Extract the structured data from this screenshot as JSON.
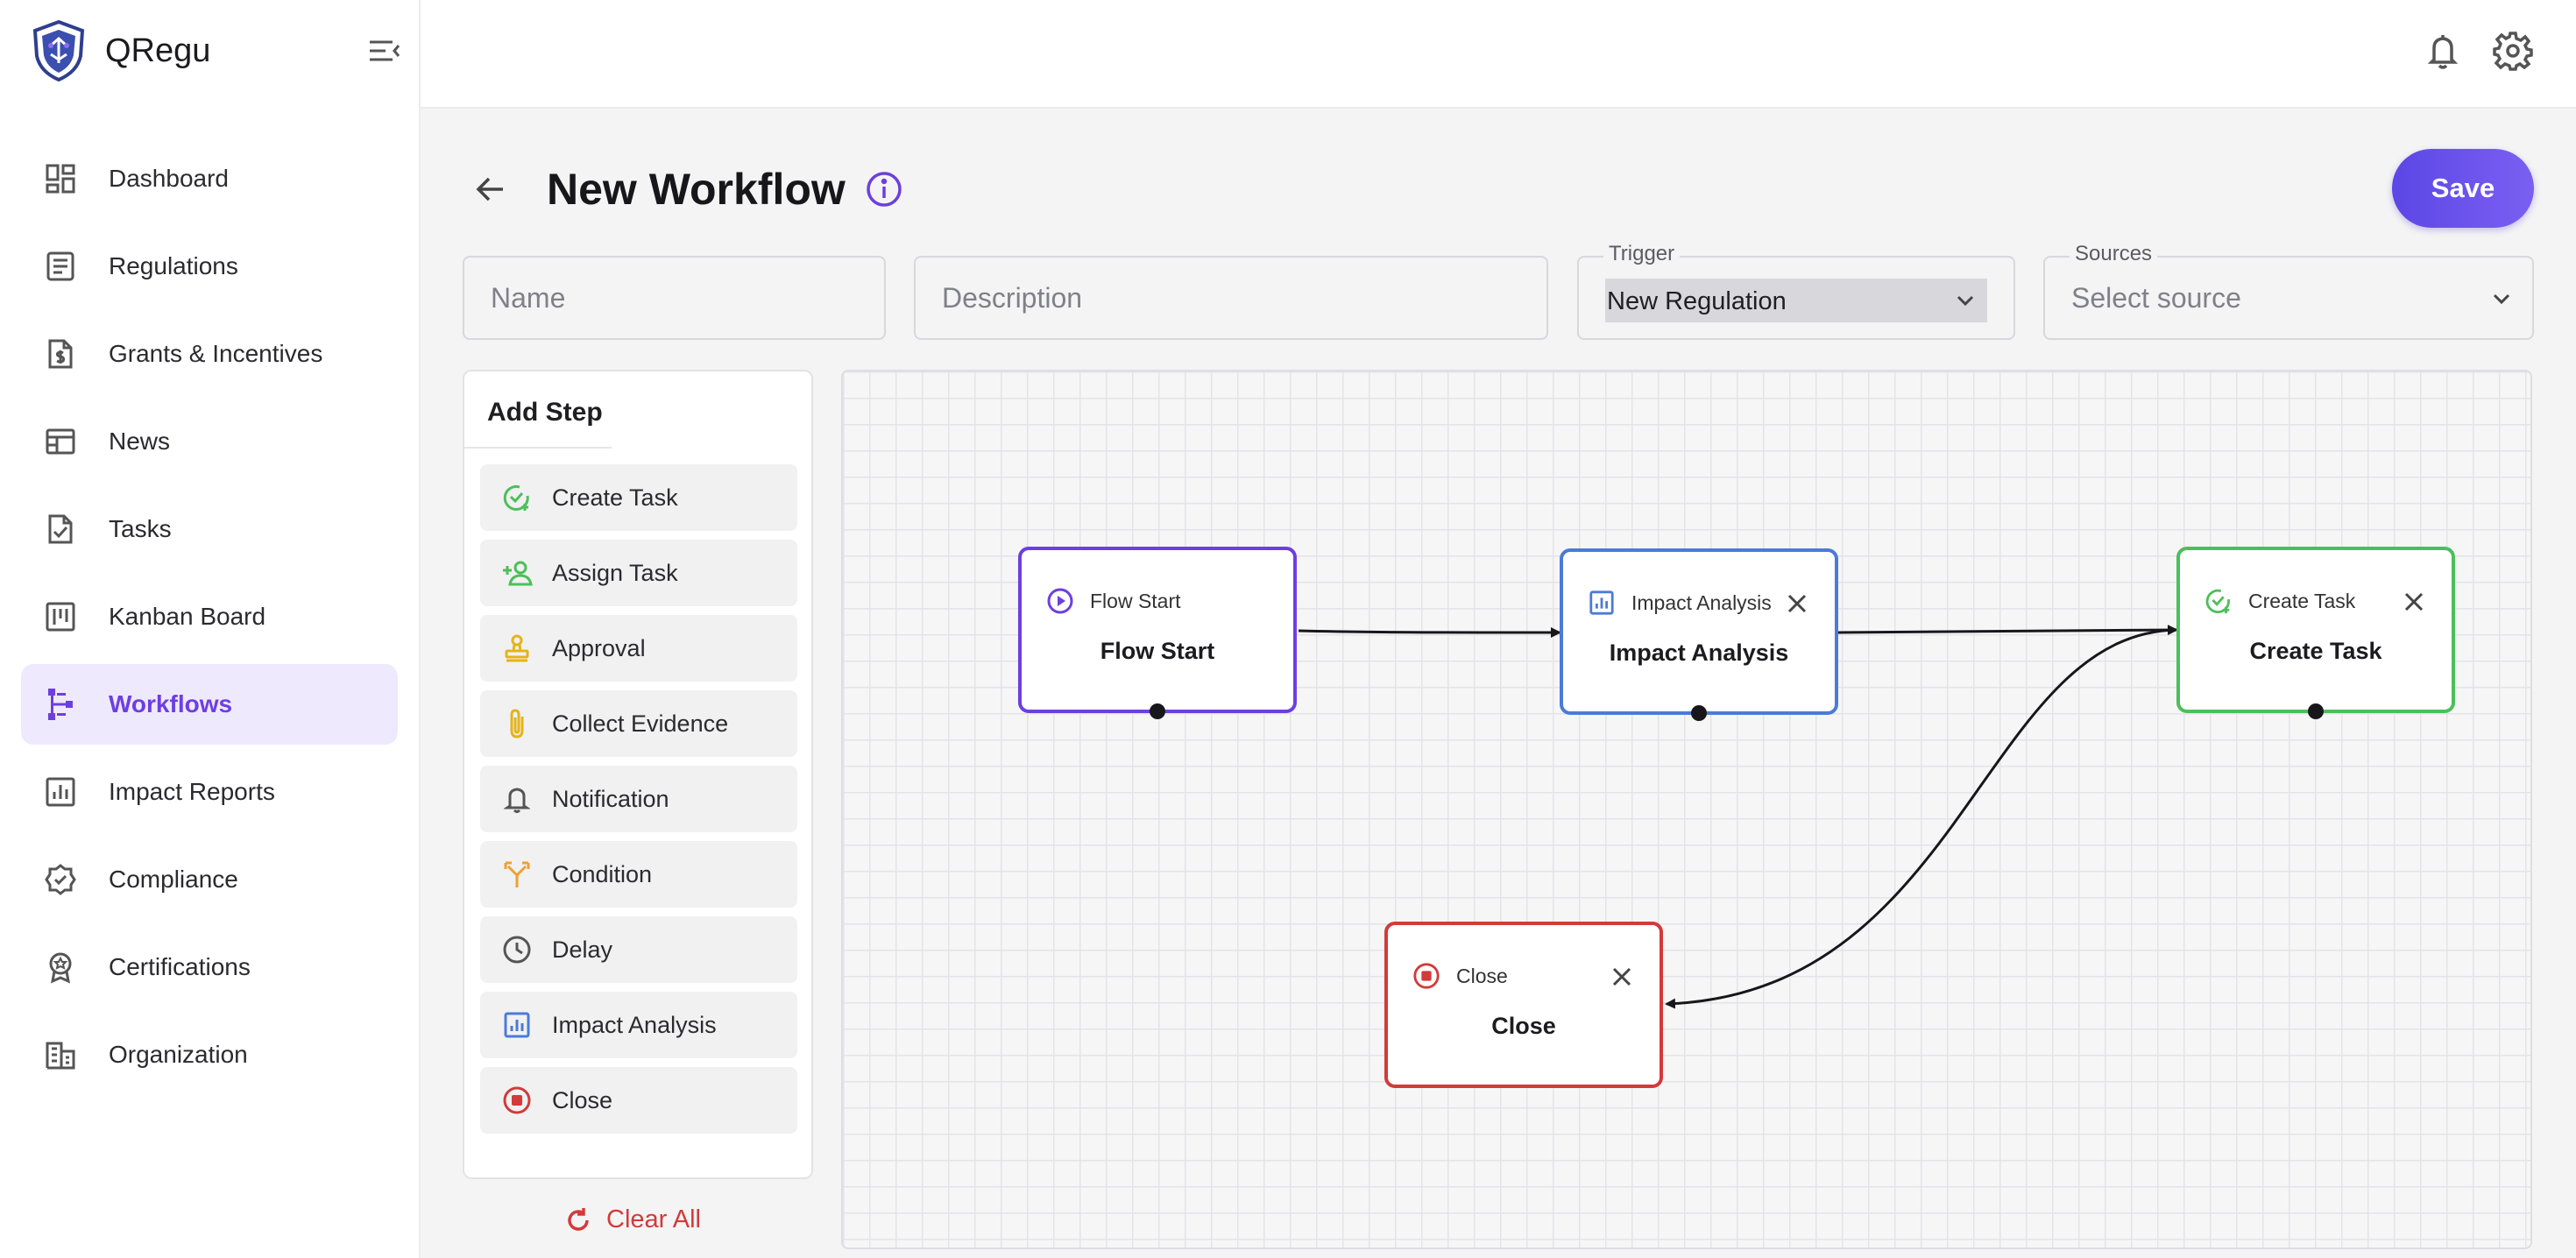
{
  "app": {
    "name": "QRegu"
  },
  "sidebar": {
    "items": [
      {
        "label": "Dashboard",
        "icon": "dashboard-icon"
      },
      {
        "label": "Regulations",
        "icon": "document-list-icon"
      },
      {
        "label": "Grants & Incentives",
        "icon": "dollar-document-icon"
      },
      {
        "label": "News",
        "icon": "newspaper-icon"
      },
      {
        "label": "Tasks",
        "icon": "task-document-icon"
      },
      {
        "label": "Kanban Board",
        "icon": "kanban-icon"
      },
      {
        "label": "Workflows",
        "icon": "workflow-icon",
        "active": true
      },
      {
        "label": "Impact Reports",
        "icon": "bar-chart-icon"
      },
      {
        "label": "Compliance",
        "icon": "verified-badge-icon"
      },
      {
        "label": "Certifications",
        "icon": "award-icon"
      },
      {
        "label": "Organization",
        "icon": "building-icon"
      }
    ]
  },
  "page": {
    "title": "New Workflow",
    "save_label": "Save"
  },
  "form": {
    "name_placeholder": "Name",
    "description_placeholder": "Description",
    "trigger_label": "Trigger",
    "trigger_value": "New Regulation",
    "sources_label": "Sources",
    "sources_placeholder": "Select source"
  },
  "steps_panel": {
    "title": "Add Step",
    "steps": [
      {
        "label": "Create Task",
        "icon": "task-check-icon"
      },
      {
        "label": "Assign Task",
        "icon": "person-add-icon"
      },
      {
        "label": "Approval",
        "icon": "stamp-icon"
      },
      {
        "label": "Collect Evidence",
        "icon": "paperclip-icon"
      },
      {
        "label": "Notification",
        "icon": "bell-icon"
      },
      {
        "label": "Condition",
        "icon": "fork-icon"
      },
      {
        "label": "Delay",
        "icon": "clock-icon"
      },
      {
        "label": "Impact Analysis",
        "icon": "chart-icon"
      },
      {
        "label": "Close",
        "icon": "stop-icon"
      }
    ],
    "clear_label": "Clear All"
  },
  "canvas": {
    "nodes": [
      {
        "type": "Flow Start",
        "label": "Flow Start",
        "color": "#6d3fe0"
      },
      {
        "type": "Impact Analysis",
        "label": "Impact Analysis",
        "color": "#4b7bd8"
      },
      {
        "type": "Create Task",
        "label": "Create Task",
        "color": "#4cbf5a"
      },
      {
        "type": "Close",
        "label": "Close",
        "color": "#d33a3a"
      }
    ]
  },
  "colors": {
    "accent": "#6d3fe0",
    "save": "#6651ea",
    "danger": "#d33a3a"
  }
}
